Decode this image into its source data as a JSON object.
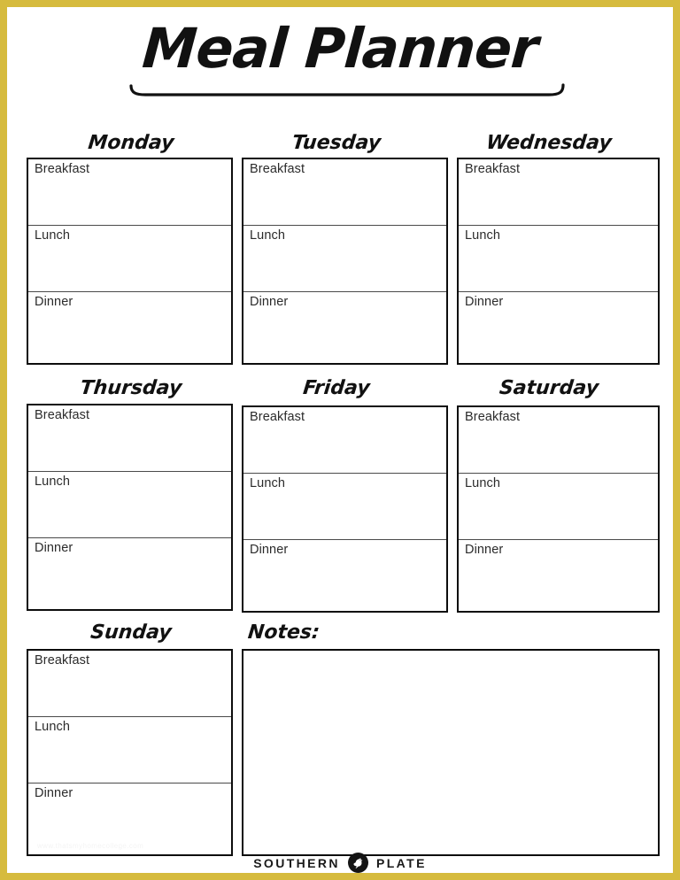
{
  "page": {
    "title": "Meal Planner",
    "border_color": "#d6bb3e",
    "background_color": "#ffffff",
    "ink_color": "#0d0d0d"
  },
  "meal_labels": [
    "Breakfast",
    "Lunch",
    "Dinner"
  ],
  "days": [
    {
      "name": "Monday",
      "meals": [
        "Breakfast",
        "Lunch",
        "Dinner"
      ]
    },
    {
      "name": "Tuesday",
      "meals": [
        "Breakfast",
        "Lunch",
        "Dinner"
      ]
    },
    {
      "name": "Wednesday",
      "meals": [
        "Breakfast",
        "Lunch",
        "Dinner"
      ]
    },
    {
      "name": "Thursday",
      "meals": [
        "Breakfast",
        "Lunch",
        "Dinner"
      ]
    },
    {
      "name": "Friday",
      "meals": [
        "Breakfast",
        "Lunch",
        "Dinner"
      ]
    },
    {
      "name": "Saturday",
      "meals": [
        "Breakfast",
        "Lunch",
        "Dinner"
      ]
    },
    {
      "name": "Sunday",
      "meals": [
        "Breakfast",
        "Lunch",
        "Dinner"
      ]
    }
  ],
  "notes": {
    "heading": "Notes:",
    "value": "",
    "placeholder": ""
  },
  "watermark": {
    "text": "www.thatsmyhomecollege.com"
  },
  "footer": {
    "word_left": "SOUTHERN",
    "word_right": "PLATE",
    "logo_name": "chicken-badge"
  }
}
